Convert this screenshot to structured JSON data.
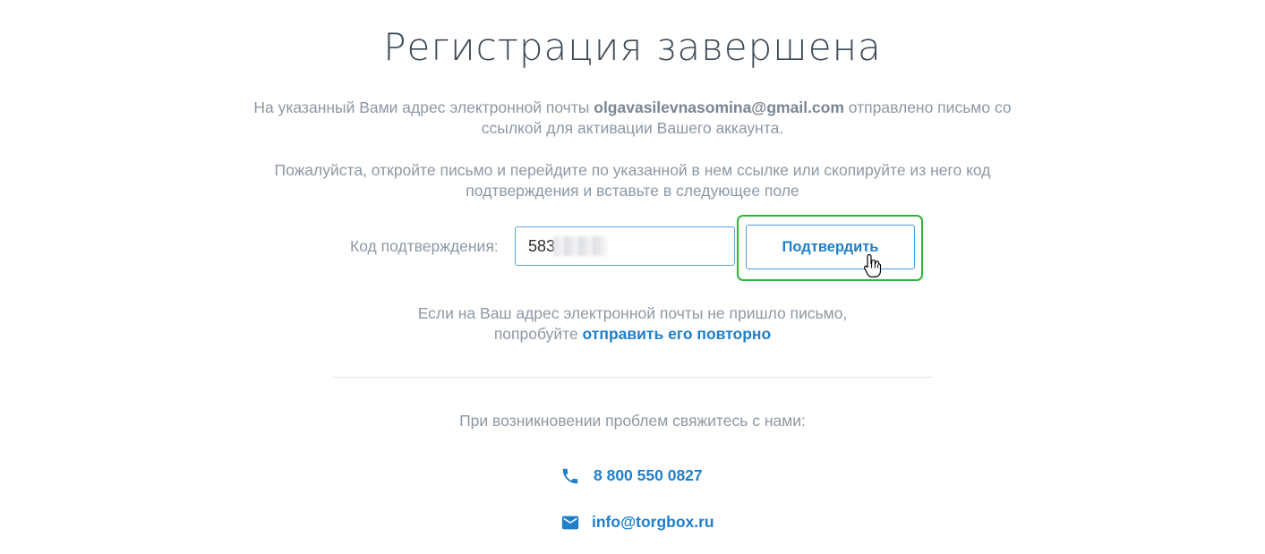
{
  "title": "Регистрация завершена",
  "info": {
    "line1_before": "На указанный Вами адрес электронной почты ",
    "email": "olgavasilevnasomina@gmail.com",
    "line1_after": " отправлено письмо со",
    "line2": "ссылкой для активации Вашего аккаунта."
  },
  "instructions": {
    "line1": "Пожалуйста, откройте письмо и перейдите по указанной в нем ссылке или скопируйте из него код",
    "line2": "подтверждения и вставьте в следующее поле"
  },
  "code_form": {
    "label": "Код подтверждения:",
    "value": "583",
    "button_label": "Подтвердить"
  },
  "resend": {
    "line1": "Если на Ваш адрес электронной почты не пришло письмо,",
    "prefix": "попробуйте ",
    "link": "отправить его повторно"
  },
  "support": {
    "text": "При возникновении проблем свяжитесь с нами:",
    "phone": "8 800 550 0827",
    "email": "info@torgbox.ru"
  },
  "icons": {
    "phone": "phone-icon",
    "mail": "mail-icon",
    "cursor": "hand-pointer-cursor"
  },
  "colors": {
    "accent": "#1f7fc9",
    "highlight": "#2db53a",
    "text_muted": "#8d98a5",
    "title": "#3e4a57"
  }
}
